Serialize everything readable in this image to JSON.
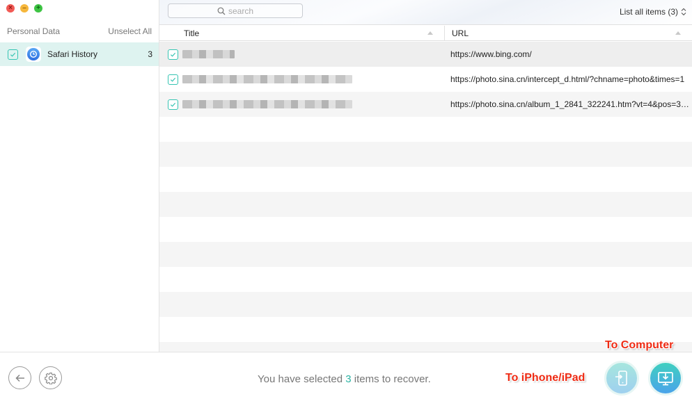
{
  "window": {
    "controls": [
      "close",
      "minimize",
      "maximize"
    ]
  },
  "sidebar": {
    "header_label": "Personal Data",
    "unselect_all": "Unselect All",
    "items": [
      {
        "label": "Safari History",
        "count": "3",
        "checked": true,
        "icon": "safari-history-icon"
      }
    ]
  },
  "toolbar": {
    "search_placeholder": "search",
    "list_filter": "List all items (3)"
  },
  "table": {
    "columns": [
      "Title",
      "URL"
    ],
    "rows": [
      {
        "title": "[blurred]",
        "url": "https://www.bing.com/",
        "checked": true
      },
      {
        "title": "[blurred]",
        "url": "https://photo.sina.cn/intercept_d.html/?chname=photo&times=1",
        "checked": true
      },
      {
        "title": "[blurred]",
        "url": "https://photo.sina.cn/album_1_2841_322241.htm?vt=4&pos=3…",
        "checked": true
      }
    ],
    "empty_rows": 9
  },
  "footer": {
    "status_prefix": "You have selected ",
    "status_count": "3",
    "status_suffix": " items to recover.",
    "to_device_label": "To iPhone/iPad",
    "to_computer_label": "To Computer"
  },
  "colors": {
    "accent": "#35c4b2",
    "annotation": "#ee2b14",
    "selected_bg": "#def3f0"
  }
}
